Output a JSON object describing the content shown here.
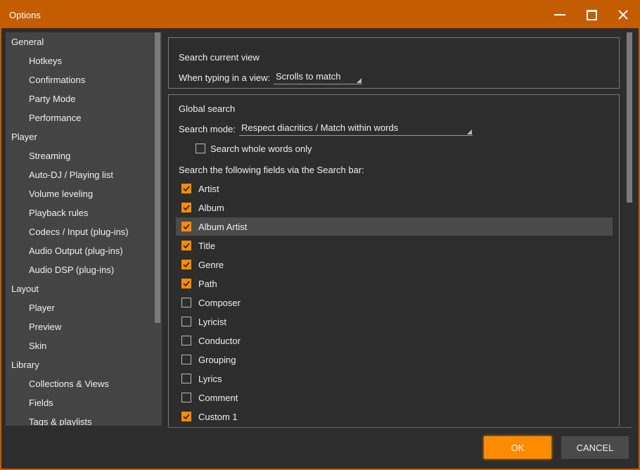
{
  "window": {
    "title": "Options",
    "accent": "#c45c00",
    "buttons": {
      "minimize": "minimize-icon",
      "maximize": "maximize-icon",
      "close": "close-icon"
    }
  },
  "sidebar": {
    "items": [
      {
        "label": "General",
        "level": "top"
      },
      {
        "label": "Hotkeys",
        "level": "sub"
      },
      {
        "label": "Confirmations",
        "level": "sub"
      },
      {
        "label": "Party Mode",
        "level": "sub"
      },
      {
        "label": "Performance",
        "level": "sub"
      },
      {
        "label": "Player",
        "level": "top"
      },
      {
        "label": "Streaming",
        "level": "sub"
      },
      {
        "label": "Auto-DJ / Playing list",
        "level": "sub"
      },
      {
        "label": "Volume leveling",
        "level": "sub"
      },
      {
        "label": "Playback rules",
        "level": "sub"
      },
      {
        "label": "Codecs / Input (plug-ins)",
        "level": "sub"
      },
      {
        "label": "Audio Output (plug-ins)",
        "level": "sub"
      },
      {
        "label": "Audio DSP (plug-ins)",
        "level": "sub"
      },
      {
        "label": "Layout",
        "level": "top"
      },
      {
        "label": "Player",
        "level": "sub"
      },
      {
        "label": "Preview",
        "level": "sub"
      },
      {
        "label": "Skin",
        "level": "sub"
      },
      {
        "label": "Library",
        "level": "top"
      },
      {
        "label": "Collections & Views",
        "level": "sub"
      },
      {
        "label": "Fields",
        "level": "sub"
      },
      {
        "label": "Tags & playlists",
        "level": "sub"
      }
    ]
  },
  "search_current_view": {
    "heading": "Search current view",
    "typing_label": "When typing in a view:",
    "typing_value": "Scrolls to match"
  },
  "global_search": {
    "heading": "Global search",
    "mode_label": "Search mode:",
    "mode_value": "Respect diacritics / Match within words",
    "whole_words_label": "Search whole words only",
    "whole_words_checked": false,
    "fields_label": "Search the following fields via the Search bar:",
    "fields": [
      {
        "label": "Artist",
        "checked": true
      },
      {
        "label": "Album",
        "checked": true
      },
      {
        "label": "Album Artist",
        "checked": true,
        "highlighted": true
      },
      {
        "label": "Title",
        "checked": true
      },
      {
        "label": "Genre",
        "checked": true
      },
      {
        "label": "Path",
        "checked": true
      },
      {
        "label": "Composer",
        "checked": false
      },
      {
        "label": "Lyricist",
        "checked": false
      },
      {
        "label": "Conductor",
        "checked": false
      },
      {
        "label": "Grouping",
        "checked": false
      },
      {
        "label": "Lyrics",
        "checked": false
      },
      {
        "label": "Comment",
        "checked": false
      },
      {
        "label": "Custom 1",
        "checked": true
      }
    ]
  },
  "footer": {
    "ok_label": "OK",
    "cancel_label": "CANCEL",
    "ok_color": "#ff8c00"
  }
}
